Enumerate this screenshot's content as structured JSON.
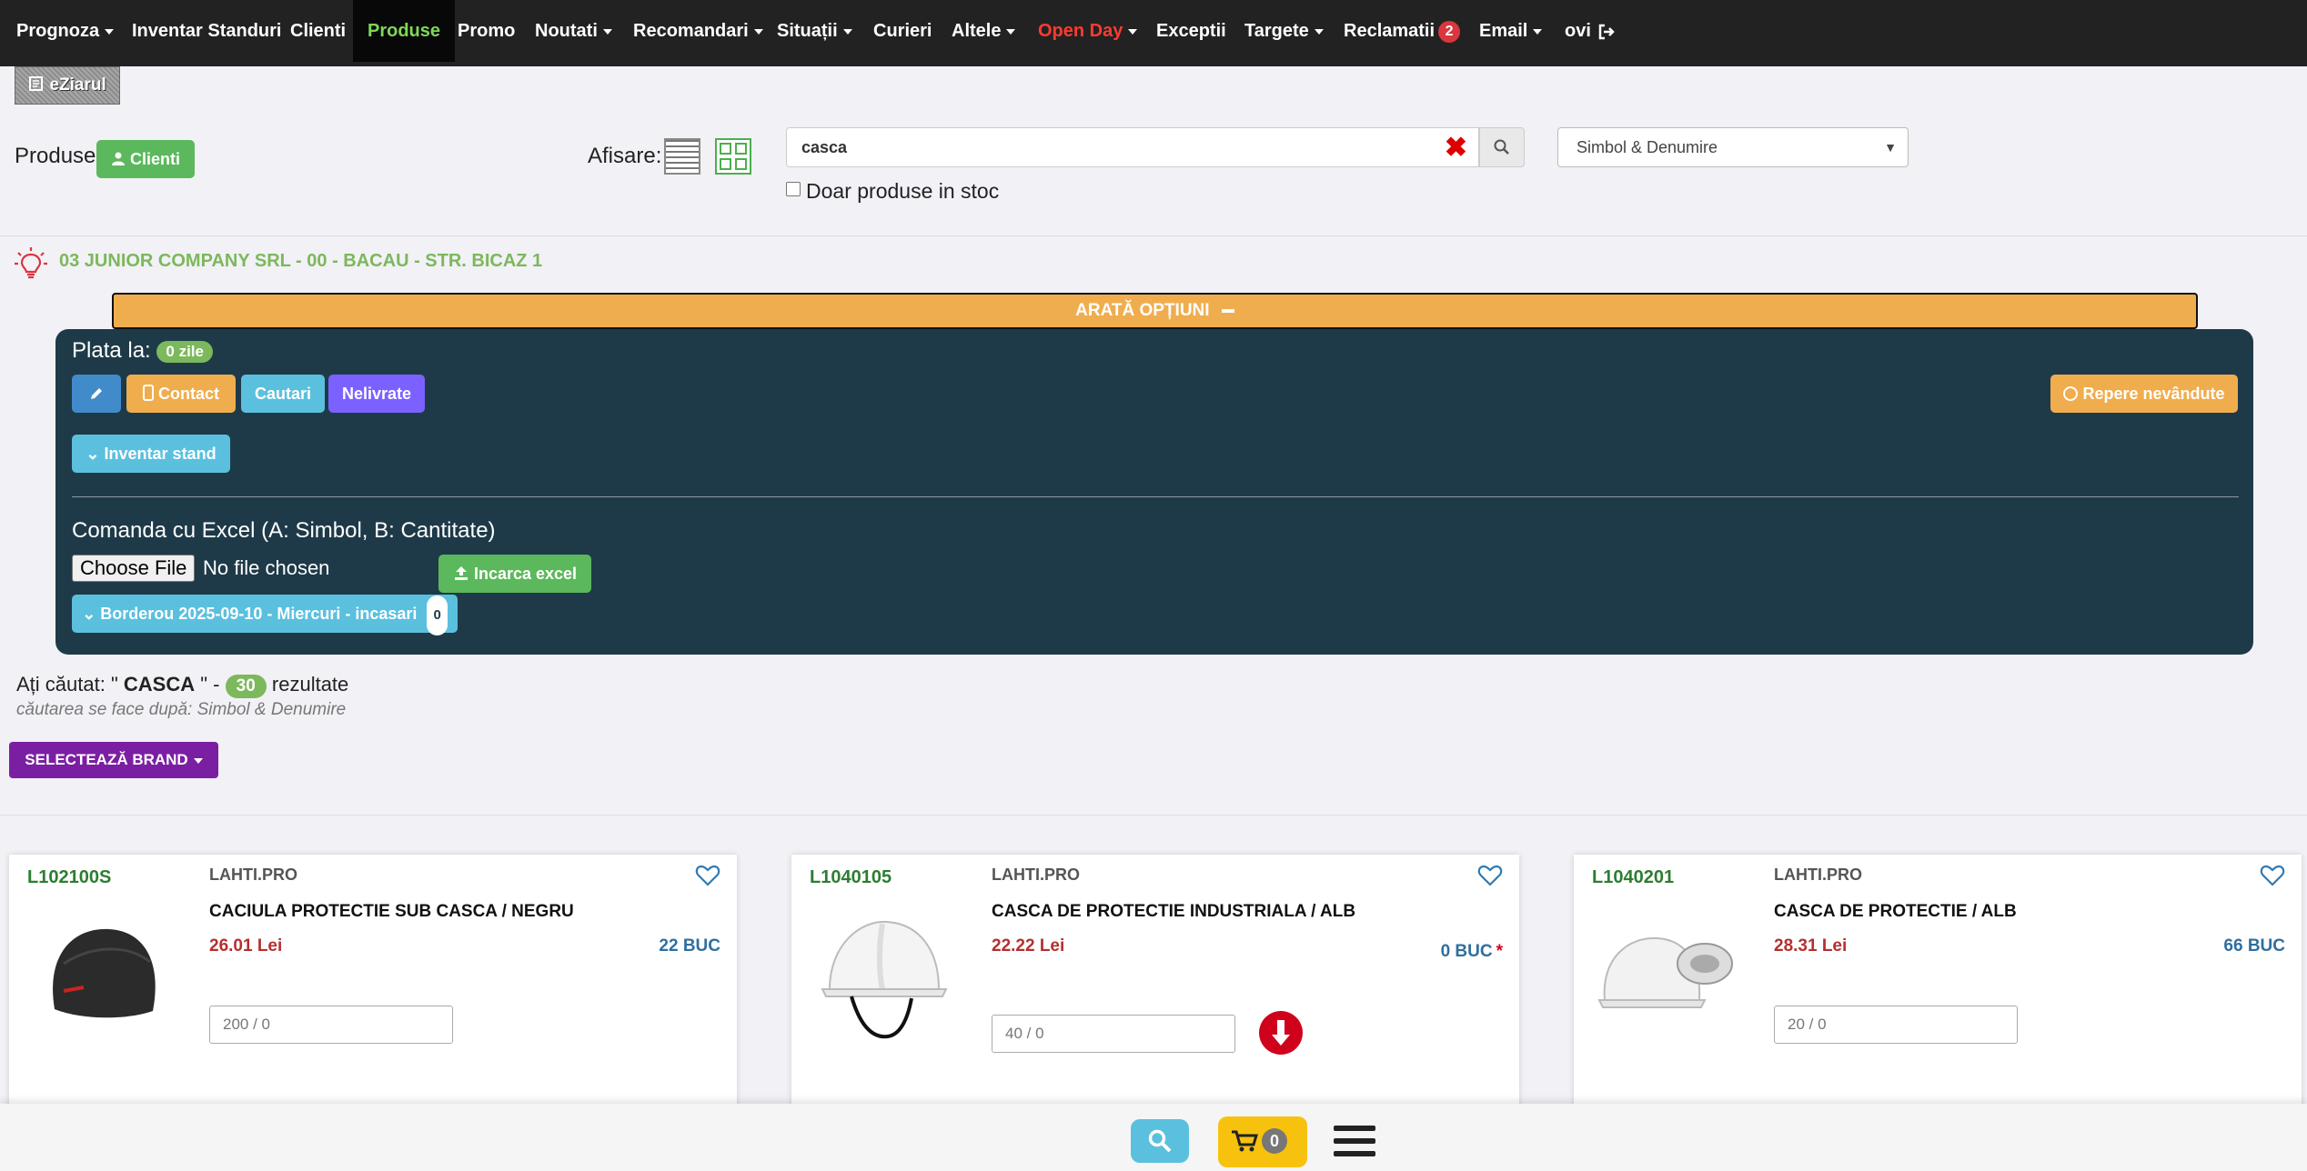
{
  "nav": {
    "items": [
      {
        "label": "Prognoza",
        "dropdown": true
      },
      {
        "label": "Inventar Standuri",
        "dropdown": false
      },
      {
        "label": "Clienti",
        "dropdown": false
      },
      {
        "label": "Produse",
        "dropdown": false,
        "active": true
      },
      {
        "label": "Promo",
        "dropdown": false
      },
      {
        "label": "Noutati",
        "dropdown": true
      },
      {
        "label": "Recomandari",
        "dropdown": true
      },
      {
        "label": "Situații",
        "dropdown": true
      },
      {
        "label": "Curieri",
        "dropdown": false
      },
      {
        "label": "Altele",
        "dropdown": true
      },
      {
        "label": "Open Day",
        "dropdown": true
      },
      {
        "label": "Exceptii",
        "dropdown": false
      },
      {
        "label": "Targete",
        "dropdown": true
      },
      {
        "label": "Reclamatii",
        "dropdown": false,
        "badge": "2"
      },
      {
        "label": "Email",
        "dropdown": true
      },
      {
        "label": "ovi",
        "dropdown": false
      }
    ],
    "active_color": "#7ed957",
    "open_day_color": "#ff3b30"
  },
  "logo": {
    "text": "eZiarul"
  },
  "header": {
    "produse_label": "Produse",
    "clienti_button": "Clienti",
    "afisare_label": "Afisare:"
  },
  "search": {
    "value": "casca",
    "in_stock_label": "Doar produse in stoc",
    "mode_selected": "Simbol & Denumire"
  },
  "client": {
    "line": "03 JUNIOR COMPANY SRL - 00 - BACAU - STR. BICAZ 1"
  },
  "options_bar": {
    "label": "ARATĂ OPȚIUNI"
  },
  "panel": {
    "plata_label": "Plata la:",
    "plata_value": "0 zile",
    "contact_button": "Contact",
    "cautari_button": "Cautari",
    "nelivrate_button": "Nelivrate",
    "repere_button": "Repere nevândute",
    "inventar_button": "Inventar stand",
    "excel_label": "Comanda cu Excel (A: Simbol, B: Cantitate)",
    "choose_file": "Choose File",
    "no_file": "No file chosen",
    "incarca_button": "Incarca excel",
    "borderou_button": "Borderou 2025-09-10 - Miercuri - incasari",
    "borderou_count": "0"
  },
  "results": {
    "prefix": "Ați căutat: \"",
    "term": "CASCA",
    "suffix": "\" -",
    "count": "30",
    "count_label": "rezultate",
    "sub": "căutarea se face după: Simbol & Denumire",
    "brand_button": "SELECTEAZĂ BRAND"
  },
  "products": [
    {
      "code": "L102100S",
      "brand": "LAHTI.PRO",
      "title": "CACIULA PROTECTIE SUB CASCA / NEGRU",
      "price": "26.01 Lei",
      "stock": "22 BUC",
      "qty": "200 / 0",
      "image": "beanie-image"
    },
    {
      "code": "L1040105",
      "brand": "LAHTI.PRO",
      "title": "CASCA DE PROTECTIE INDUSTRIALA / ALB",
      "price": "22.22 Lei",
      "stock": "0 BUC",
      "stock_flag": "*",
      "qty": "40 / 0",
      "image": "helmet-image",
      "alert": true
    },
    {
      "code": "L1040201",
      "brand": "LAHTI.PRO",
      "title": "CASCA DE PROTECTIE / ALB",
      "price": "28.31 Lei",
      "stock": "66 BUC",
      "qty": "20 / 0",
      "image": "helmet-image"
    }
  ],
  "bottom_bar": {
    "cart_count": "0"
  }
}
